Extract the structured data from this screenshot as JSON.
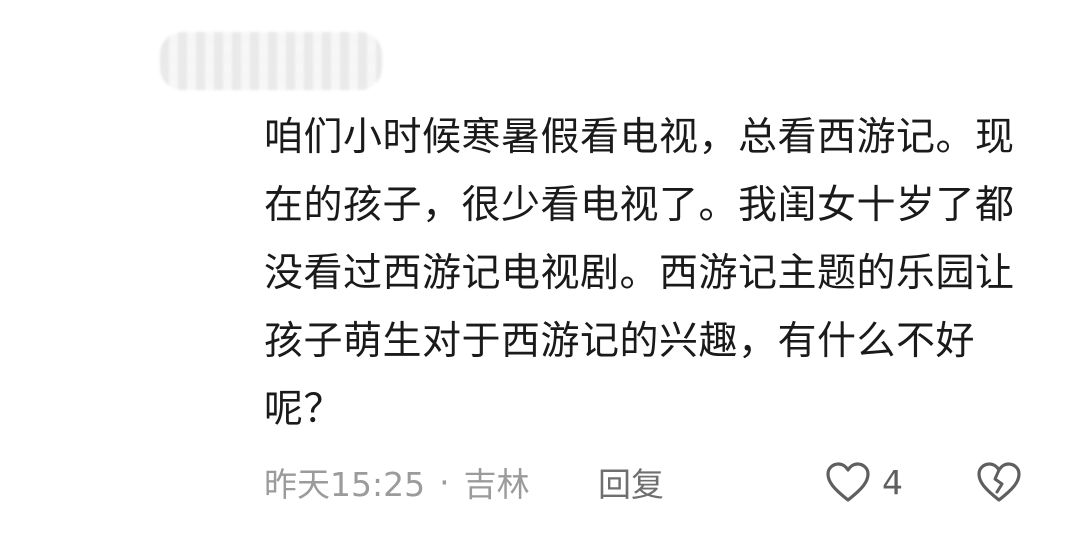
{
  "comment": {
    "text": "咱们小时候寒暑假看电视，总看西游记。现在的孩子，很少看电视了。我闺女十岁了都没看过西游记电视剧。西游记主题的乐园让孩子萌生对于西游记的兴趣，有什么不好呢？",
    "timestamp": "昨天15:25",
    "separator": "·",
    "location": "吉林",
    "reply_label": "回复",
    "like_count": "4"
  },
  "icons": {
    "like": "heart-outline-icon",
    "dislike": "broken-heart-icon"
  },
  "colors": {
    "text": "#1a1a1a",
    "meta": "#9b9b9b",
    "icon": "#5f5f5f"
  }
}
